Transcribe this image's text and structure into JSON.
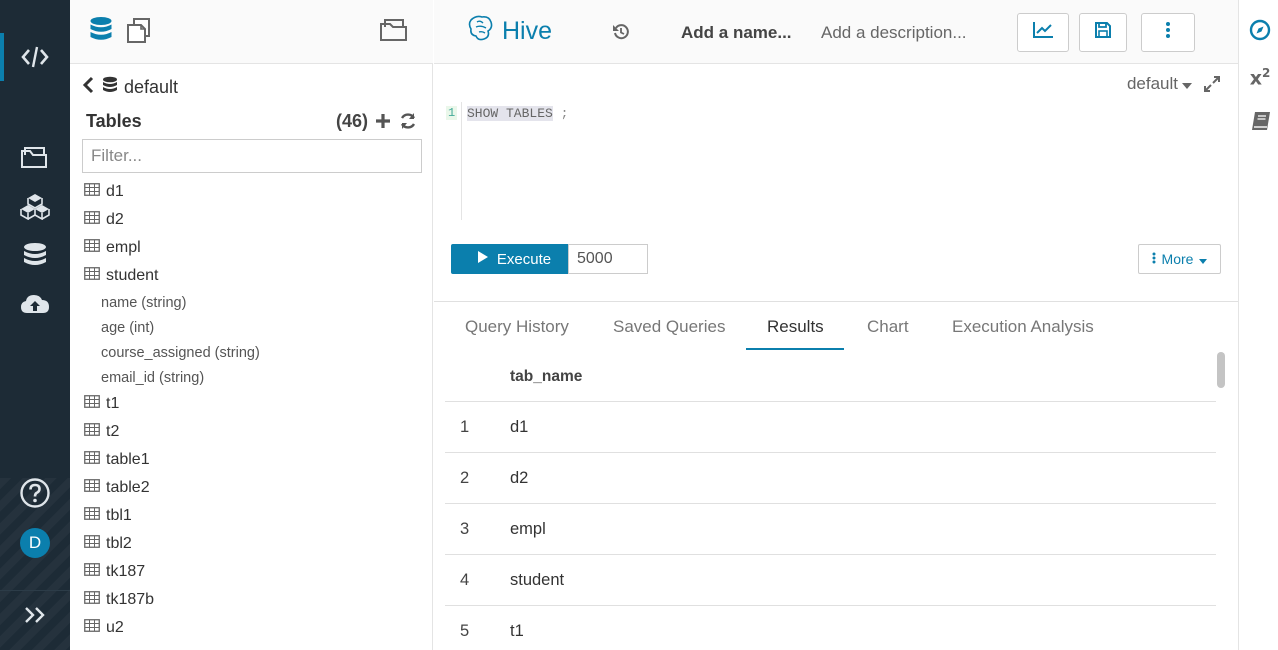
{
  "colors": {
    "accent": "#0b7fad",
    "nav_bg": "#1d2b36"
  },
  "nav": {
    "items": [
      {
        "icon": "code-icon",
        "active": true
      },
      {
        "icon": "folder-open-icon"
      },
      {
        "icon": "cubes-icon"
      },
      {
        "icon": "database-icon"
      },
      {
        "icon": "cloud-upload-icon"
      },
      {
        "icon": "help-icon"
      },
      {
        "icon": "expand-chevrons-icon"
      }
    ],
    "avatar_letter": "D"
  },
  "assist": {
    "database": "default",
    "tables_title": "Tables",
    "tables_count": "(46)",
    "filter_placeholder": "Filter...",
    "tables": [
      {
        "name": "d1"
      },
      {
        "name": "d2"
      },
      {
        "name": "empl"
      },
      {
        "name": "student",
        "columns": [
          "name (string)",
          "age (int)",
          "course_assigned (string)",
          "email_id (string)"
        ]
      },
      {
        "name": "t1"
      },
      {
        "name": "t2"
      },
      {
        "name": "table1"
      },
      {
        "name": "table2"
      },
      {
        "name": "tbl1"
      },
      {
        "name": "tbl2"
      },
      {
        "name": "tk187"
      },
      {
        "name": "tk187b"
      },
      {
        "name": "u2"
      }
    ]
  },
  "header": {
    "engine": "Hive",
    "name_placeholder": "Add a name...",
    "description_placeholder": "Add a description..."
  },
  "editor": {
    "context": "default",
    "line_number": "1",
    "code_keyword": "SHOW TABLES",
    "code_terminator": ";",
    "execute_label": "Execute",
    "limit_value": "5000",
    "more_label": "More"
  },
  "result_tabs": [
    {
      "label": "Query History"
    },
    {
      "label": "Saved Queries"
    },
    {
      "label": "Results",
      "active": true
    },
    {
      "label": "Chart"
    },
    {
      "label": "Execution Analysis"
    }
  ],
  "results": {
    "column_header": "tab_name",
    "rows": [
      {
        "index": "1",
        "value": "d1"
      },
      {
        "index": "2",
        "value": "d2"
      },
      {
        "index": "3",
        "value": "empl"
      },
      {
        "index": "4",
        "value": "student"
      },
      {
        "index": "5",
        "value": "t1"
      }
    ]
  },
  "right_rail": {
    "items": [
      {
        "icon": "compass-icon"
      },
      {
        "icon": "superscript-icon",
        "label": "x²"
      },
      {
        "icon": "book-icon"
      }
    ]
  }
}
